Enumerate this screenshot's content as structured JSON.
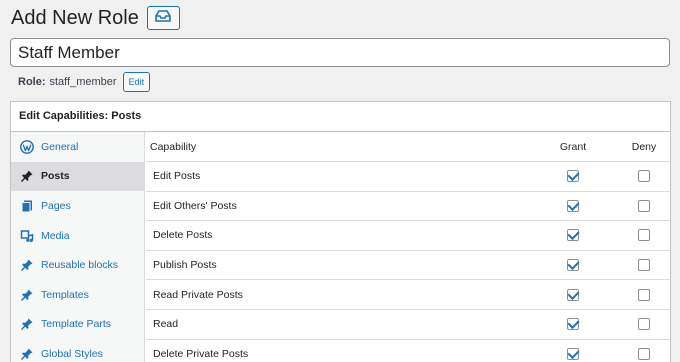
{
  "header": {
    "title": "Add New Role"
  },
  "role": {
    "name_value": "Staff Member",
    "label": "Role:",
    "slug": "staff_member",
    "edit_label": "Edit"
  },
  "panel": {
    "title": "Edit Capabilities: Posts",
    "sidebar": [
      {
        "label": "General",
        "icon": "wordpress-icon",
        "active": false
      },
      {
        "label": "Posts",
        "icon": "pin-icon",
        "active": true
      },
      {
        "label": "Pages",
        "icon": "pages-icon",
        "active": false
      },
      {
        "label": "Media",
        "icon": "media-icon",
        "active": false
      },
      {
        "label": "Reusable blocks",
        "icon": "pin-icon",
        "active": false
      },
      {
        "label": "Templates",
        "icon": "pin-icon",
        "active": false
      },
      {
        "label": "Template Parts",
        "icon": "pin-icon",
        "active": false
      },
      {
        "label": "Global Styles",
        "icon": "pin-icon",
        "active": false
      }
    ],
    "columns": {
      "capability": "Capability",
      "grant": "Grant",
      "deny": "Deny"
    },
    "rows": [
      {
        "capability": "Edit Posts",
        "grant": true,
        "deny": false
      },
      {
        "capability": "Edit Others' Posts",
        "grant": true,
        "deny": false
      },
      {
        "capability": "Delete Posts",
        "grant": true,
        "deny": false
      },
      {
        "capability": "Publish Posts",
        "grant": true,
        "deny": false
      },
      {
        "capability": "Read Private Posts",
        "grant": true,
        "deny": false
      },
      {
        "capability": "Read",
        "grant": true,
        "deny": false
      },
      {
        "capability": "Delete Private Posts",
        "grant": true,
        "deny": false
      }
    ]
  },
  "colors": {
    "accent": "#2271b1",
    "active_bg": "#dcdcde",
    "page_bg": "#f0f0f1"
  }
}
